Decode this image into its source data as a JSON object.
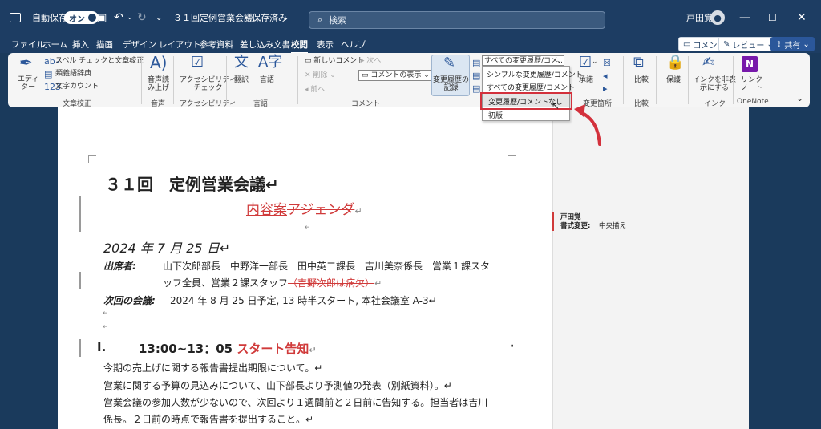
{
  "titlebar": {
    "autosave_label": "自動保存",
    "toggle_state": "オン",
    "doc_title": "３１回定例営業会議…",
    "save_status": "• 保存済み",
    "search_placeholder": "検索",
    "user_name": "戸田覚"
  },
  "menu": {
    "items": [
      "ファイル",
      "ホーム",
      "挿入",
      "描画",
      "デザイン",
      "レイアウト",
      "参考資料",
      "差し込み文書",
      "校閲",
      "表示",
      "ヘルプ"
    ],
    "active_index": 8,
    "comment_button": "コメント",
    "review_button": "レビュー",
    "share_button": "共有"
  },
  "ribbon": {
    "editor": "エディ\nター",
    "spell": "スペル チェックと文章校正",
    "thesaurus": "類義語辞典",
    "wordcount": "文字カウント",
    "grp_proof": "文章校正",
    "read_aloud": "音声読\nみ上げ",
    "grp_speech": "音声",
    "access_check": "アクセシビリティ\nチェック",
    "grp_access": "アクセシビリティ",
    "translate": "翻訳",
    "language": "言語",
    "grp_lang": "言語",
    "new_comment": "新しいコメント",
    "delete": "削除",
    "prev": "前へ",
    "next": "次へ",
    "show_comments": "コメントの表示",
    "grp_comment": "コメント",
    "track_changes": "変更履歴の\n記録",
    "markup_select": "すべての変更履歴/コメ…",
    "accept": "承諾",
    "grp_changes": "変更箇所",
    "compare": "比較",
    "grp_compare": "比較",
    "protect": "保護",
    "hide_ink": "インクを非表\n示にする",
    "grp_ink": "インク",
    "linked_notes": "リンク\nノート",
    "grp_onenote": "OneNote"
  },
  "dropdown": {
    "options": [
      "シンプルな変更履歴/コメント",
      "すべての変更履歴/コメント",
      "変更履歴/コメントなし",
      "初版"
    ],
    "highlighted_index": 2
  },
  "document": {
    "title": "３１回　定例営業会議↵",
    "subtitle_inserted": "内容案",
    "subtitle_deleted": "アジェンダ",
    "date": "2024 年 7 月 25 日↵",
    "attendees_label": "出席者:",
    "attendees_line1": "山下次郎部長　中野洋一部長　田中英二課長　吉川美奈係長　営業１課スタ",
    "attendees_line2": "ッフ全員、営業２課スタッフ",
    "attendees_deleted": "（吉野次郎は病欠）",
    "next_meeting_label": "次回の会議:",
    "next_meeting_text": "2024 年 8 月 25 日予定, 13 時半スタート, 本社会議室 A-3↵",
    "section_number": "I.",
    "section_time": "13:00~13：05",
    "section_title": "スタート告知",
    "body_lines": [
      "今期の売上げに関する報告書提出期限について。↵",
      "営業に関する予算の見込みについて、山下部長より予測値の発表（別紙資料）。↵",
      "営業会議の参加人数が少ないので、次回より１週間前と２日前に告知する。担当者は吉川",
      "係長。２日前の時点で報告書を提出すること。↵"
    ]
  },
  "margin_note": {
    "author": "戸田覚",
    "label": "書式変更:",
    "value": "中央揃え"
  },
  "colors": {
    "title_bar": "#1d3d63",
    "revision_red": "#d03a3a",
    "highlight_box": "#d3313c",
    "active_item_bg": "#dbe6f2"
  }
}
